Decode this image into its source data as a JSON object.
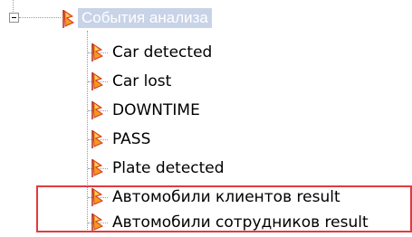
{
  "tree": {
    "root": {
      "label": "События анализа",
      "icon": "orange-flag-icon",
      "expanded": true
    },
    "children": [
      {
        "label": "Car detected",
        "icon": "orange-flag-icon"
      },
      {
        "label": "Car lost",
        "icon": "orange-flag-icon"
      },
      {
        "label": "DOWNTIME",
        "icon": "orange-flag-icon"
      },
      {
        "label": "PASS",
        "icon": "orange-flag-icon"
      },
      {
        "label": "Plate detected",
        "icon": "orange-flag-icon"
      },
      {
        "label": "Автомобили клиентов result",
        "icon": "orange-flag-icon"
      },
      {
        "label": "Автомобили сотрудников result",
        "icon": "orange-flag-icon"
      }
    ]
  },
  "colors": {
    "highlight_border": "#e03a42",
    "selected_background": "#c8d3e8",
    "icon_orange": "#f39a1c",
    "icon_red": "#d9361b"
  }
}
